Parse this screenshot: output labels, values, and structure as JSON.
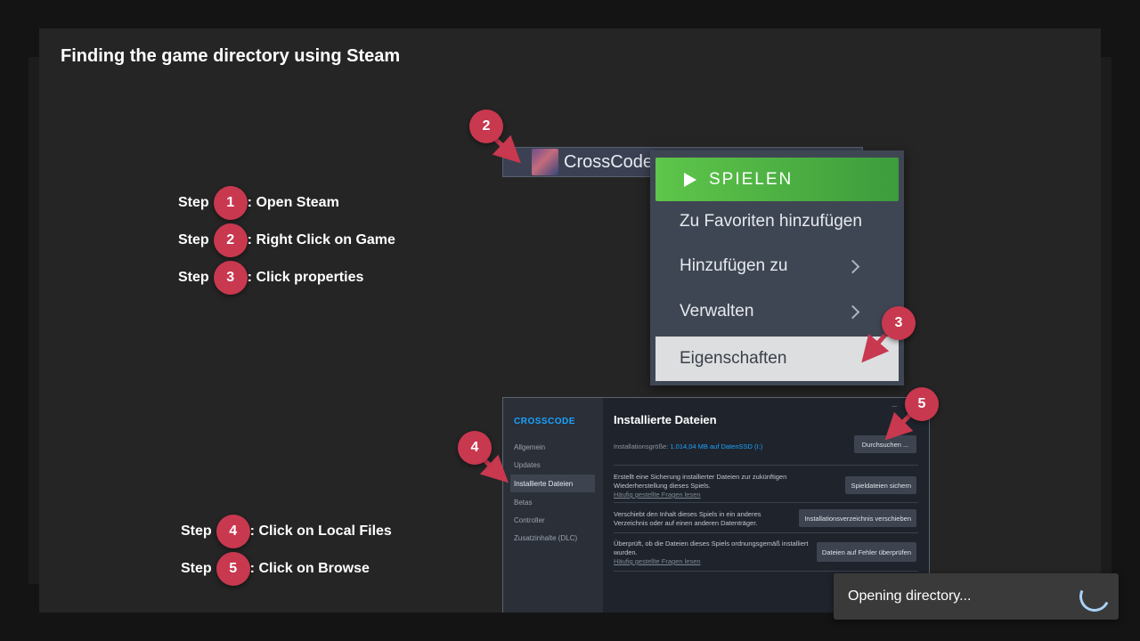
{
  "dialog": {
    "title": "Finding the game directory using Steam"
  },
  "steps": [
    {
      "word": "Step",
      "number": "1",
      "text": ": Open Steam"
    },
    {
      "word": "Step",
      "number": "2",
      "text": ": Right Click on Game"
    },
    {
      "word": "Step",
      "number": "3",
      "text": ": Click properties"
    },
    {
      "word": "Step",
      "number": "4",
      "text": ": Click on Local Files"
    },
    {
      "word": "Step",
      "number": "5",
      "text": ": Click on Browse"
    }
  ],
  "markers": [
    "2",
    "3",
    "4",
    "5"
  ],
  "library": {
    "game_name": "CrossCode"
  },
  "context_menu": {
    "play": "SPIELEN",
    "items": [
      "Zu Favoriten hinzufügen",
      "Hinzufügen zu",
      "Verwalten",
      "Eigenschaften"
    ]
  },
  "properties": {
    "game_title": "CROSSCODE",
    "nav": [
      "Allgemein",
      "Updates",
      "Installierte Dateien",
      "Betas",
      "Controller",
      "Zusatzinhalte (DLC)"
    ],
    "heading": "Installierte Dateien",
    "window_min": "–",
    "size_label": "Installationsgröße:",
    "size_value": "1.014,04 MB auf DatenSSD (I:)",
    "browse_button": "Durchsuchen ...",
    "rows": [
      {
        "text": "Erstellt eine Sicherung installierter Dateien zur zukünftigen Wiederherstellung dieses Spiels.",
        "link": "Häufig gestellte Fragen lesen",
        "button": "Spieldateien sichern"
      },
      {
        "text": "Verschiebt den Inhalt dieses Spiels in ein anderes Verzeichnis oder auf einen anderen Datenträger.",
        "link": "",
        "button": "Installationsverzeichnis verschieben"
      },
      {
        "text": "Überprüft, ob die Dateien dieses Spiels ordnungsgemäß installiert wurden.",
        "link": "Häufig gestellte Fragen lesen",
        "button": "Dateien auf Fehler überprüfen"
      }
    ]
  },
  "toast": {
    "text": "Opening directory..."
  },
  "colors": {
    "badge": "#c8384f",
    "play_green": "#5ec64a",
    "steam_blue": "#1aa3ff",
    "spinner": "#a9d2f5"
  }
}
